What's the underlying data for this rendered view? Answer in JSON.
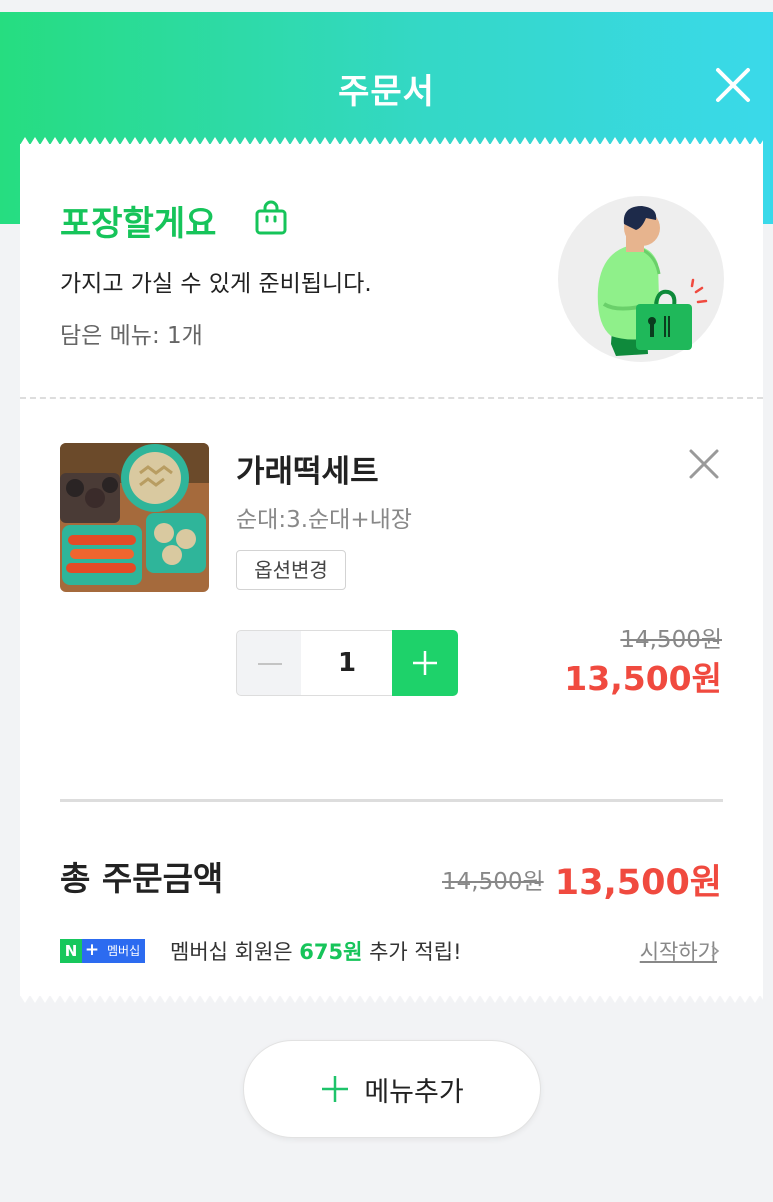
{
  "header": {
    "title": "주문서"
  },
  "pickup": {
    "title": "포장할게요",
    "description": "가지고 가실 수 있게 준비됩니다.",
    "menu_count": "담은 메뉴: 1개"
  },
  "item": {
    "name": "가래떡세트",
    "option": "순대:3.순대+내장",
    "change_option_label": "옵션변경",
    "quantity": "1",
    "original_price": "14,500원",
    "sale_price": "13,500원"
  },
  "total": {
    "label": "총 주문금액",
    "original_price": "14,500원",
    "sale_price": "13,500원"
  },
  "membership": {
    "badge_n": "N",
    "badge_plus": "+",
    "badge_text": "멤버십",
    "text_before": "멤버십 회원은 ",
    "points": "675원",
    "text_after": " 추가 적립!",
    "start_link": "시작하기"
  },
  "add_menu": {
    "label": "메뉴추가"
  },
  "colors": {
    "accent_green": "#16c45a",
    "price_red": "#f04a3f",
    "stepper_green": "#1ed26a",
    "membership_blue": "#2c6bf0"
  },
  "icons": {
    "close": "close-icon",
    "bag": "shopping-bag-icon",
    "remove": "close-icon",
    "minus": "minus-icon",
    "plus": "plus-icon",
    "chevron": "chevron-right-icon"
  }
}
